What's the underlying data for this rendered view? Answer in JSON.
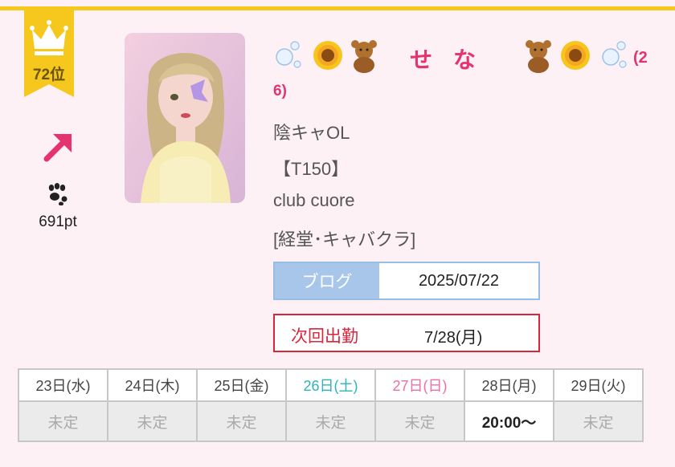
{
  "rank": {
    "label": "72位"
  },
  "points": {
    "label": "691pt"
  },
  "cast": {
    "name": "せな",
    "name_suffix_line1": "(2",
    "name_suffix_line2": "6)",
    "catchphrase": "陰キャOL",
    "height": "【T150】",
    "club": "club cuore",
    "area_category": "[経堂･キャバクラ]"
  },
  "blog": {
    "label": "ブログ",
    "date": "2025/07/22"
  },
  "next_shift": {
    "label": "次回出勤",
    "date": "7/28(月)"
  },
  "schedule": {
    "days": [
      {
        "label": "23日(水)",
        "color": "#444444",
        "value": "未定"
      },
      {
        "label": "24日(木)",
        "color": "#444444",
        "value": "未定"
      },
      {
        "label": "25日(金)",
        "color": "#444444",
        "value": "未定"
      },
      {
        "label": "26日(土)",
        "color": "#2fb3b8",
        "value": "未定"
      },
      {
        "label": "27日(日)",
        "color": "#f06ea6",
        "value": "未定"
      },
      {
        "label": "28日(月)",
        "color": "#444444",
        "value": "20:00〜"
      },
      {
        "label": "29日(火)",
        "color": "#444444",
        "value": "未定"
      }
    ]
  },
  "colors": {
    "accent": "#e5336f",
    "rank_gold": "#f6c81d",
    "blog_blue": "#a8c6ea",
    "next_red": "#d8263c"
  },
  "icons": [
    "crown-icon",
    "trend-up-arrow-icon",
    "paw-icon",
    "bubbles-emoji",
    "sunflower-emoji",
    "teddy-bear-emoji"
  ]
}
